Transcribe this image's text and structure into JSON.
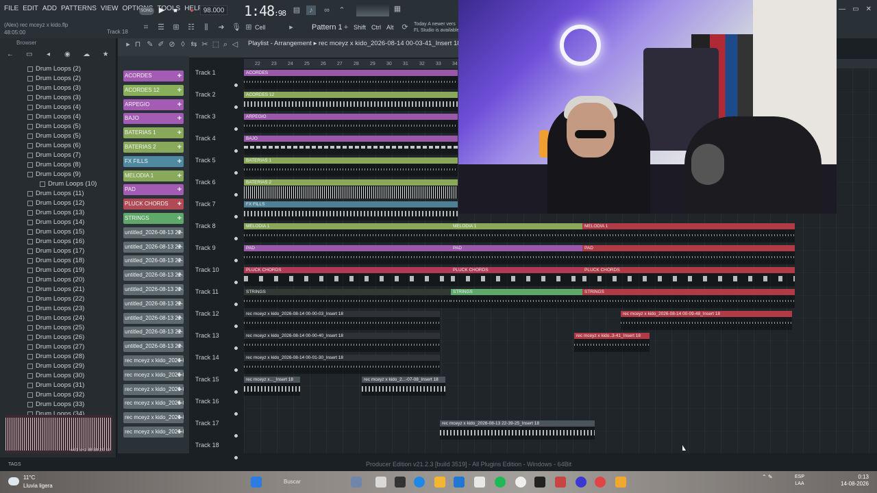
{
  "menu": [
    "FILE",
    "EDIT",
    "ADD",
    "PATTERNS",
    "VIEW",
    "OPTIONS",
    "TOOLS",
    "HELP"
  ],
  "toolbar": {
    "song_mode": "SONG",
    "tempo": "98.000",
    "time_main": "1:48",
    "time_sub": ":98",
    "cell_label": "Cell",
    "pattern": "Pattern 1",
    "mod_shift": "Shift",
    "mod_ctrl": "Ctrl",
    "mod_alt": "Alt",
    "news_line1": "Today  A newer vers",
    "news_line2": "FL Studio is available"
  },
  "project": {
    "title": "(Alex) rec mceyz x kido.flp",
    "time": "48:05:00",
    "track_hint": "Track 18"
  },
  "browser": {
    "header": "Browser",
    "items": [
      {
        "label": "Drum Loops  (2)",
        "sub": false
      },
      {
        "label": "Drum Loops  (2)",
        "sub": false
      },
      {
        "label": "Drum Loops  (3)",
        "sub": false
      },
      {
        "label": "Drum Loops  (3)",
        "sub": false
      },
      {
        "label": "Drum Loops  (4)",
        "sub": false
      },
      {
        "label": "Drum Loops  (4)",
        "sub": false
      },
      {
        "label": "Drum Loops  (5)",
        "sub": false
      },
      {
        "label": "Drum Loops  (5)",
        "sub": false
      },
      {
        "label": "Drum Loops  (6)",
        "sub": false
      },
      {
        "label": "Drum Loops  (7)",
        "sub": false
      },
      {
        "label": "Drum Loops  (8)",
        "sub": false
      },
      {
        "label": "Drum Loops  (9)",
        "sub": false
      },
      {
        "label": "Drum Loops  (10)",
        "sub": true
      },
      {
        "label": "Drum Loops  (11)",
        "sub": false
      },
      {
        "label": "Drum Loops  (12)",
        "sub": false
      },
      {
        "label": "Drum Loops  (13)",
        "sub": false
      },
      {
        "label": "Drum Loops  (14)",
        "sub": false
      },
      {
        "label": "Drum Loops  (15)",
        "sub": false
      },
      {
        "label": "Drum Loops  (16)",
        "sub": false
      },
      {
        "label": "Drum Loops  (17)",
        "sub": false
      },
      {
        "label": "Drum Loops  (18)",
        "sub": false
      },
      {
        "label": "Drum Loops  (19)",
        "sub": false
      },
      {
        "label": "Drum Loops  (20)",
        "sub": false
      },
      {
        "label": "Drum Loops  (21)",
        "sub": false
      },
      {
        "label": "Drum Loops  (22)",
        "sub": false
      },
      {
        "label": "Drum Loops  (23)",
        "sub": false
      },
      {
        "label": "Drum Loops  (24)",
        "sub": false
      },
      {
        "label": "Drum Loops  (25)",
        "sub": false
      },
      {
        "label": "Drum Loops  (26)",
        "sub": false
      },
      {
        "label": "Drum Loops  (27)",
        "sub": false
      },
      {
        "label": "Drum Loops  (28)",
        "sub": false
      },
      {
        "label": "Drum Loops  (29)",
        "sub": false
      },
      {
        "label": "Drum Loops  (30)",
        "sub": false
      },
      {
        "label": "Drum Loops  (31)",
        "sub": false
      },
      {
        "label": "Drum Loops  (32)",
        "sub": false
      },
      {
        "label": "Drum Loops  (33)",
        "sub": false
      },
      {
        "label": "Drum Loops  (34)",
        "sub": false
      }
    ],
    "preview_info": "44.1 kHz 88 Bit 2.0 M",
    "tags_label": "TAGS"
  },
  "playlist": {
    "title": "Playlist - Arrangement",
    "subtitle": "rec mceyz x kido_2026-08-14 00-03-41_Insert 18",
    "ruler": [
      "22",
      "23",
      "24",
      "25",
      "26",
      "27",
      "28",
      "29",
      "30",
      "31",
      "32",
      "33",
      "34"
    ]
  },
  "channels": [
    {
      "label": "ACORDES",
      "color": "#a45bb3"
    },
    {
      "label": "ACORDES 12",
      "color": "#88b05a"
    },
    {
      "label": "ARPEGIO",
      "color": "#a45bb3"
    },
    {
      "label": "BAJO",
      "color": "#a45bb3"
    },
    {
      "label": "BATERIAS 1",
      "color": "#88a85a"
    },
    {
      "label": "BATERIAS 2",
      "color": "#88a85a"
    },
    {
      "label": "FX FILLS",
      "color": "#4f8aa0"
    },
    {
      "label": "MELODIA 1",
      "color": "#88a85a"
    },
    {
      "label": "PAD",
      "color": "#a45bb3"
    },
    {
      "label": "PLUCK CHORDS",
      "color": "#b04a55"
    },
    {
      "label": "STRINGS",
      "color": "#5ea86a"
    },
    {
      "label": "untitled_2026-08-13 22-...",
      "color": "#5e6a70"
    },
    {
      "label": "untitled_2026-08-13 22-...",
      "color": "#5e6a70"
    },
    {
      "label": "untitled_2026-08-13 22-...",
      "color": "#5e6a70"
    },
    {
      "label": "untitled_2026-08-13 22-...",
      "color": "#5e6a70"
    },
    {
      "label": "untitled_2026-08-13 22-...",
      "color": "#5e6a70"
    },
    {
      "label": "untitled_2026-08-13 22-...",
      "color": "#5e6a70"
    },
    {
      "label": "untitled_2026-08-13 22-...",
      "color": "#5e6a70"
    },
    {
      "label": "untitled_2026-08-13 22-...",
      "color": "#5e6a70"
    },
    {
      "label": "untitled_2026-08-13 22-...",
      "color": "#5e6a70"
    },
    {
      "label": "rec mceyz x kido_2026-0...",
      "color": "#5e6a70"
    },
    {
      "label": "rec mceyz x kido_2026-0...",
      "color": "#5e6a70"
    },
    {
      "label": "rec mceyz x kido_2026-0...",
      "color": "#5e6a70"
    },
    {
      "label": "rec mceyz x kido_2026-0...",
      "color": "#5e6a70"
    },
    {
      "label": "rec mceyz x kido_2026-0...",
      "color": "#5e6a70"
    },
    {
      "label": "rec mceyz x kido_2026-0...",
      "color": "#5e6a70"
    }
  ],
  "tracks": [
    "Track 1",
    "Track 2",
    "Track 3",
    "Track 4",
    "Track 5",
    "Track 6",
    "Track 7",
    "Track 8",
    "Track 9",
    "Track 10",
    "Track 11",
    "Track 12",
    "Track 13",
    "Track 14",
    "Track 15",
    "Track 16",
    "Track 17",
    "Track 18"
  ],
  "clips": [
    {
      "track": 0,
      "start": 0,
      "end": 312,
      "label": "ACORDES",
      "color": "#9a58ab",
      "wave": "thin"
    },
    {
      "track": 1,
      "start": 0,
      "end": 312,
      "label": "ACORDES 12",
      "color": "#8aa85a",
      "wave": "mid"
    },
    {
      "track": 2,
      "start": 0,
      "end": 312,
      "label": "ARPEGIO",
      "color": "#9a58ab",
      "wave": "thin"
    },
    {
      "track": 3,
      "start": 0,
      "end": 312,
      "label": "BAJO",
      "color": "#9a58ab",
      "wave": "dash"
    },
    {
      "track": 4,
      "start": 0,
      "end": 312,
      "label": "BATERIAS 1",
      "color": "#8aa85a",
      "wave": "thin"
    },
    {
      "track": 5,
      "start": 0,
      "end": 312,
      "label": "BATERIAS 2",
      "color": "#8aa85a",
      "wave": "thick"
    },
    {
      "track": 6,
      "start": 0,
      "end": 312,
      "label": "FX FILLS",
      "color": "#4e8096",
      "wave": "mid"
    },
    {
      "track": 7,
      "start": 0,
      "end": 302,
      "label": "MELODIA 1",
      "color": "#8aa85a",
      "wave": "thin"
    },
    {
      "track": 7,
      "start": 302,
      "end": 494,
      "label": "MELODIA 1",
      "color": "#8aa85a",
      "wave": "thin"
    },
    {
      "track": 7,
      "start": 494,
      "end": 804,
      "label": "MELODIA 1",
      "color": "#b03a45",
      "wave": "thin"
    },
    {
      "track": 8,
      "start": 0,
      "end": 302,
      "label": "PAD",
      "color": "#9a58ab",
      "wave": "thin"
    },
    {
      "track": 8,
      "start": 302,
      "end": 494,
      "label": "PAD",
      "color": "#9a58ab",
      "wave": "thin"
    },
    {
      "track": 8,
      "start": 494,
      "end": 804,
      "label": "PAD",
      "color": "#b03a45",
      "wave": "thin"
    },
    {
      "track": 9,
      "start": 0,
      "end": 302,
      "label": "PLUCK CHORDS",
      "color": "#b03a55",
      "wave": "tri"
    },
    {
      "track": 9,
      "start": 302,
      "end": 494,
      "label": "PLUCK CHORDS",
      "color": "#b03a55",
      "wave": "tri"
    },
    {
      "track": 9,
      "start": 494,
      "end": 804,
      "label": "PLUCK CHORDS",
      "color": "#b03a45",
      "wave": "tri"
    },
    {
      "track": 10,
      "start": 0,
      "end": 302,
      "label": "STRINGS",
      "color": "#2f3a35",
      "wave": "thin"
    },
    {
      "track": 10,
      "start": 302,
      "end": 494,
      "label": "STRINGS",
      "color": "#5ea86a",
      "wave": "thin"
    },
    {
      "track": 10,
      "start": 494,
      "end": 804,
      "label": "STRINGS",
      "color": "#b03a45",
      "wave": "thin"
    },
    {
      "track": 11,
      "start": 0,
      "end": 286,
      "label": "rec mceyz x kido_2026-08-14 00-00-03_Insert 18",
      "color": "#2c3337",
      "wave": "thin"
    },
    {
      "track": 11,
      "start": 550,
      "end": 800,
      "label": "rec mceyz x kido_2026-08-14 00-09-48_Insert 18",
      "color": "#b03a45",
      "wave": "thin"
    },
    {
      "track": 12,
      "start": 0,
      "end": 286,
      "label": "rec mceyz x kido_2026-08-14 00-00-40_Insert 18",
      "color": "#2c3337",
      "wave": "thin"
    },
    {
      "track": 12,
      "start": 482,
      "end": 592,
      "label": "rec mceyz x kido..3-41_Insert 18",
      "color": "#b03a45",
      "wave": "thin"
    },
    {
      "track": 13,
      "start": 0,
      "end": 286,
      "label": "rec mceyz x kido_2026-08-14 00-01-30_Insert 18",
      "color": "#2c3337",
      "wave": "thin"
    },
    {
      "track": 14,
      "start": 0,
      "end": 82,
      "label": "rec mceyz x..._Insert 18",
      "color": "#4a5459",
      "wave": "mid"
    },
    {
      "track": 14,
      "start": 172,
      "end": 294,
      "label": "rec mceyz x kido_2...-07-08_Insert 18",
      "color": "#4a5459",
      "wave": "mid"
    },
    {
      "track": 16,
      "start": 286,
      "end": 512,
      "label": "rec mceyz x kido_2026-08-13 22-39-25_Insert 18",
      "color": "#4a5459",
      "wave": "mid"
    }
  ],
  "status": "Producer Edition v21.2.3 [build 3519] - All Plugins Edition - Windows - 64Bit",
  "taskbar": {
    "temp": "11°C",
    "weather": "Lluvia ligera",
    "search": "Buscar",
    "lang1": "ESP",
    "lang2": "LAA",
    "time": "0:13",
    "date": "14-08-2026"
  }
}
